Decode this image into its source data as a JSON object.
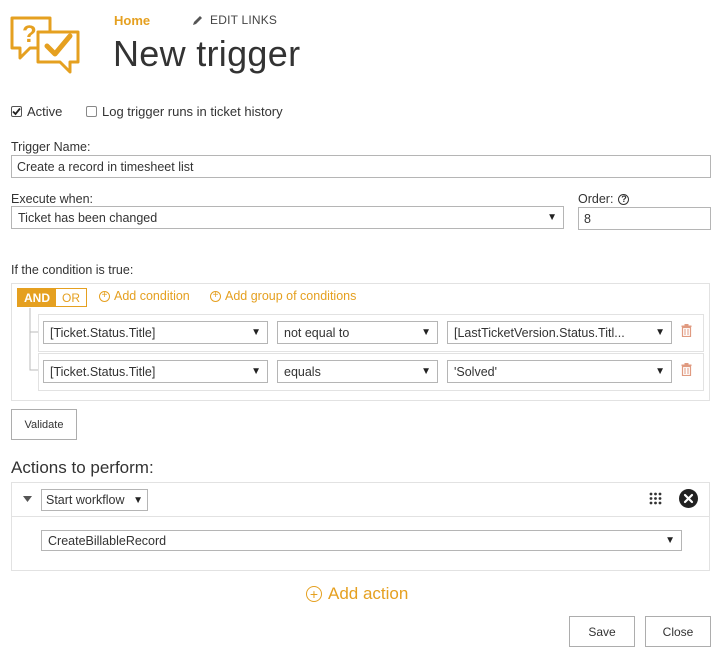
{
  "nav": {
    "home": "Home",
    "edit_links": "EDIT LINKS"
  },
  "page": {
    "title": "New trigger"
  },
  "options": {
    "active": {
      "label": "Active",
      "checked": true
    },
    "log_runs": {
      "label": "Log trigger runs in ticket history",
      "checked": false
    }
  },
  "trigger_name": {
    "label": "Trigger Name:",
    "value": "Create a record in timesheet list"
  },
  "execute_when": {
    "label": "Execute when:",
    "value": "Ticket has been changed"
  },
  "order": {
    "label": "Order:",
    "value": "8"
  },
  "condition": {
    "label": "If the condition is true:",
    "and": "AND",
    "or": "OR",
    "add_condition": "Add condition",
    "add_group": "Add group of conditions",
    "rows": [
      {
        "field": "[Ticket.Status.Title]",
        "operator": "not equal to",
        "value": "[LastTicketVersion.Status.Titl..."
      },
      {
        "field": "[Ticket.Status.Title]",
        "operator": "equals",
        "value": "'Solved'"
      }
    ]
  },
  "validate_label": "Validate",
  "actions": {
    "heading": "Actions to perform:",
    "type": "Start workflow",
    "workflow": "CreateBillableRecord",
    "add_action": "Add action"
  },
  "footer": {
    "save": "Save",
    "close": "Close"
  },
  "colors": {
    "accent": "#e5a020",
    "border": "#b5b5b5"
  }
}
